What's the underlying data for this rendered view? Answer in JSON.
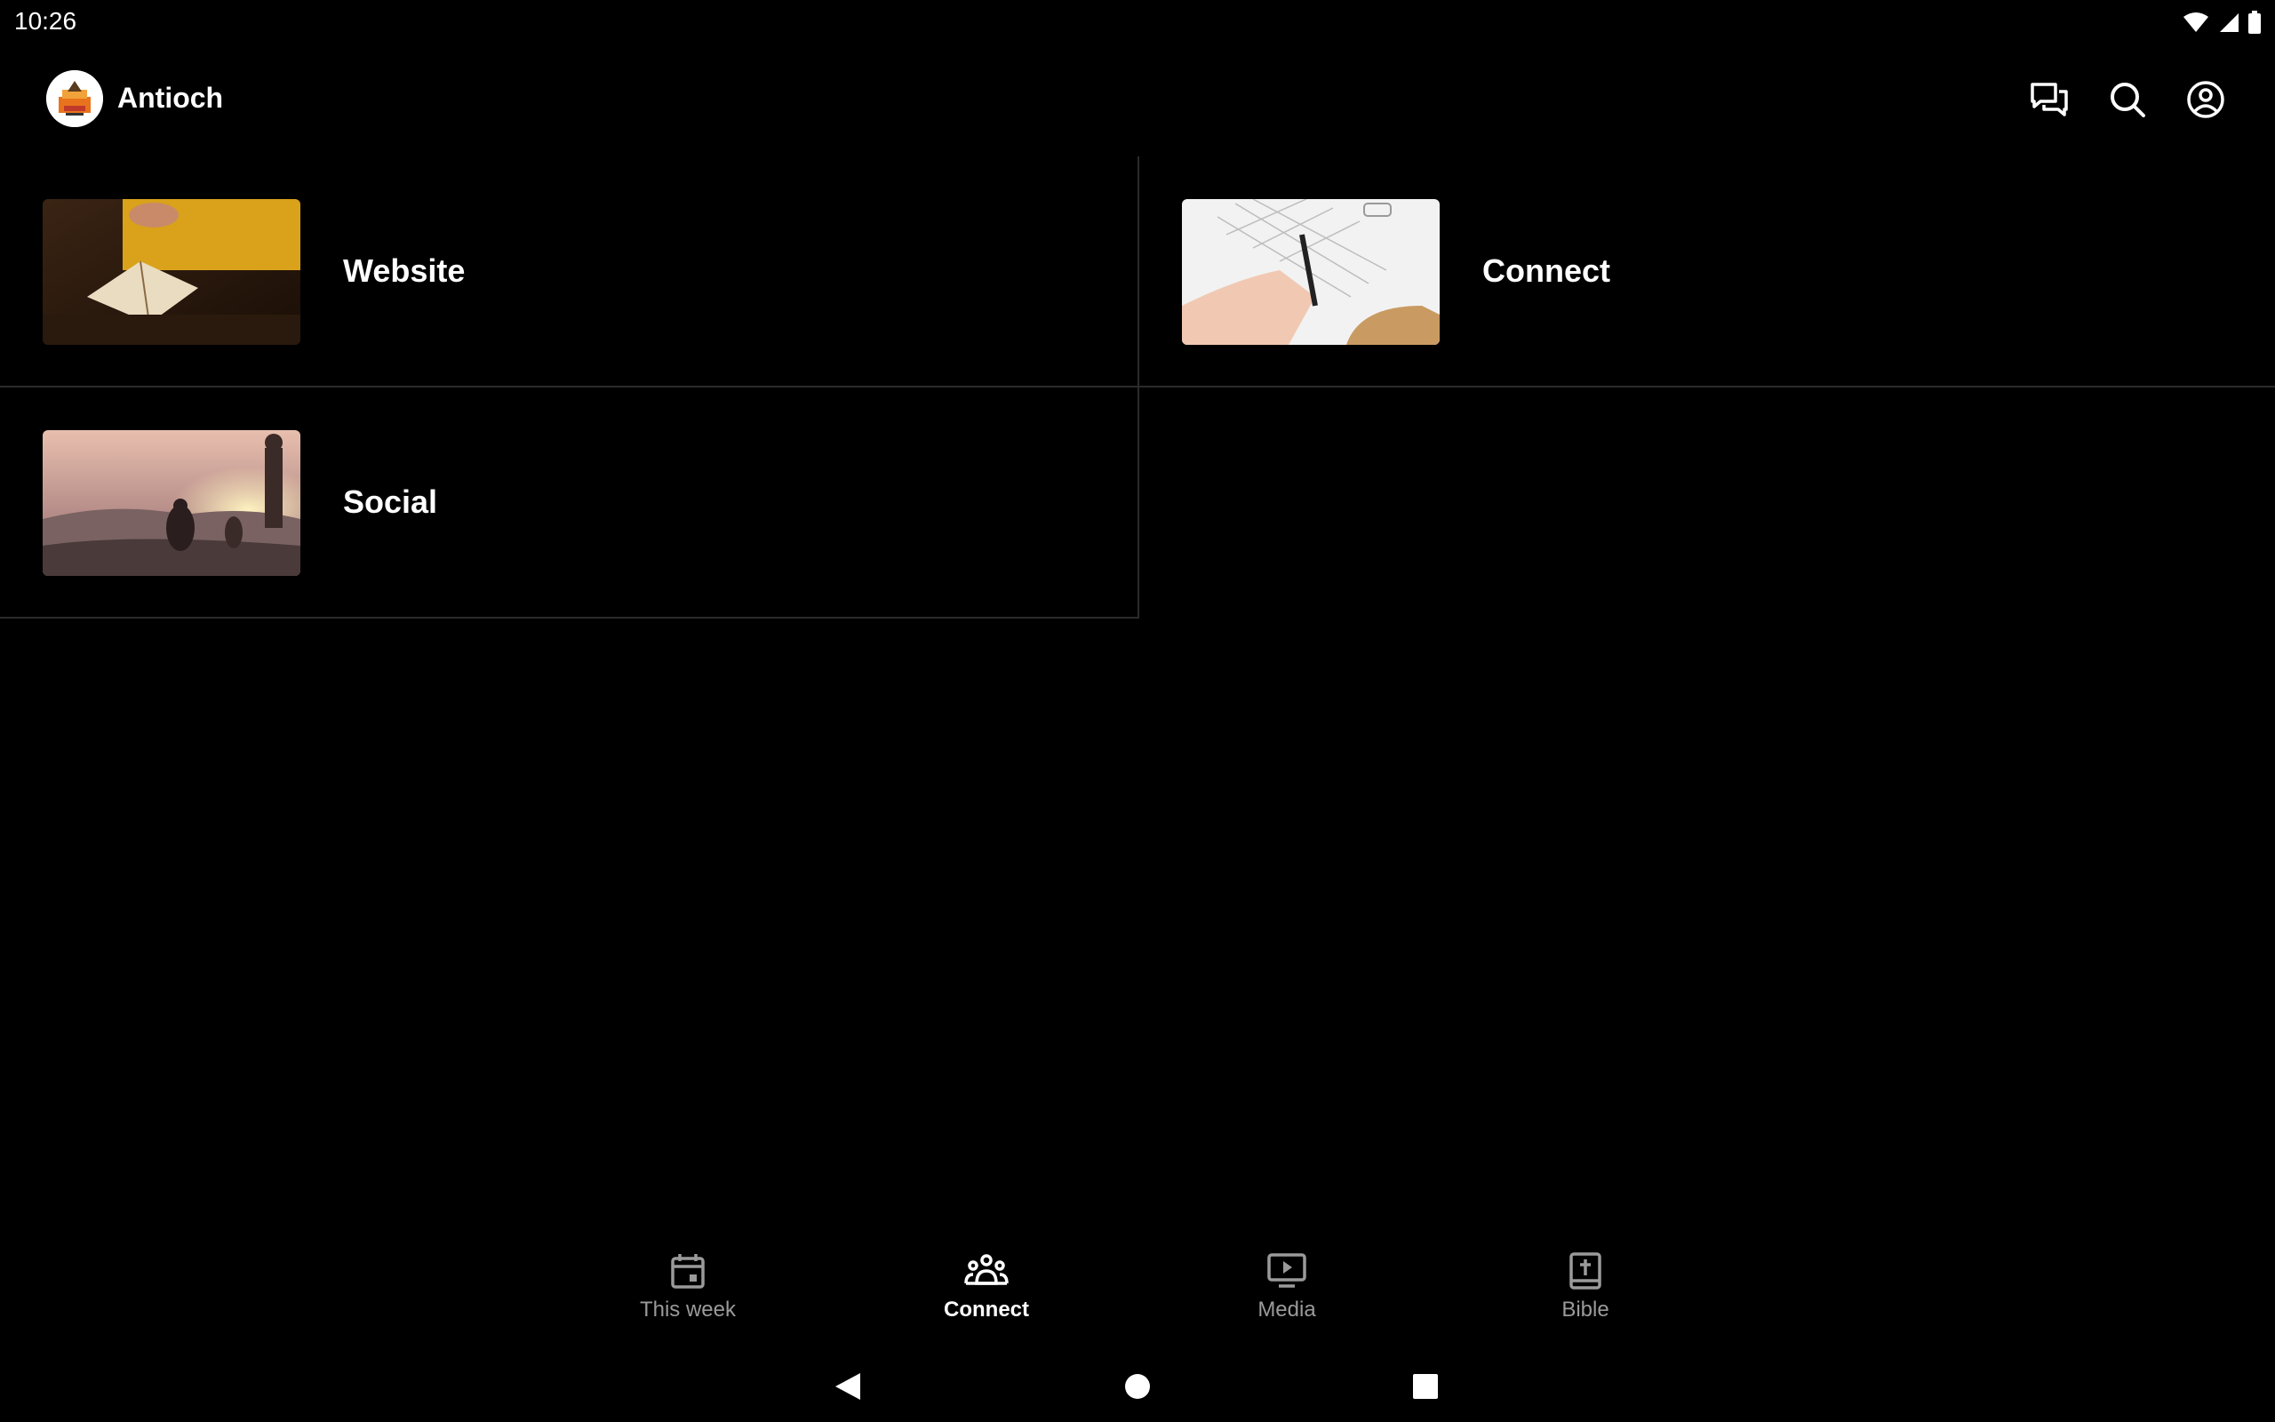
{
  "status": {
    "time": "10:26"
  },
  "app": {
    "title": "Antioch"
  },
  "colors": {
    "background": "#000000",
    "text": "#ffffff",
    "inactive": "#9a9a9a",
    "divider": "#2b2b2b"
  },
  "top_actions": [
    {
      "name": "messages-icon"
    },
    {
      "name": "search-icon"
    },
    {
      "name": "account-icon"
    }
  ],
  "tiles": [
    {
      "label": "Website",
      "image": "woman-reading-bible-photo"
    },
    {
      "label": "Connect",
      "image": "hands-writing-notebook-photo"
    },
    {
      "label": "Social",
      "image": "people-on-mountain-sunset-photo"
    }
  ],
  "bottom_nav": [
    {
      "label": "This week",
      "icon": "calendar-icon",
      "active": false
    },
    {
      "label": "Connect",
      "icon": "people-group-icon",
      "active": true
    },
    {
      "label": "Media",
      "icon": "tv-play-icon",
      "active": false
    },
    {
      "label": "Bible",
      "icon": "bible-cross-icon",
      "active": false
    }
  ]
}
